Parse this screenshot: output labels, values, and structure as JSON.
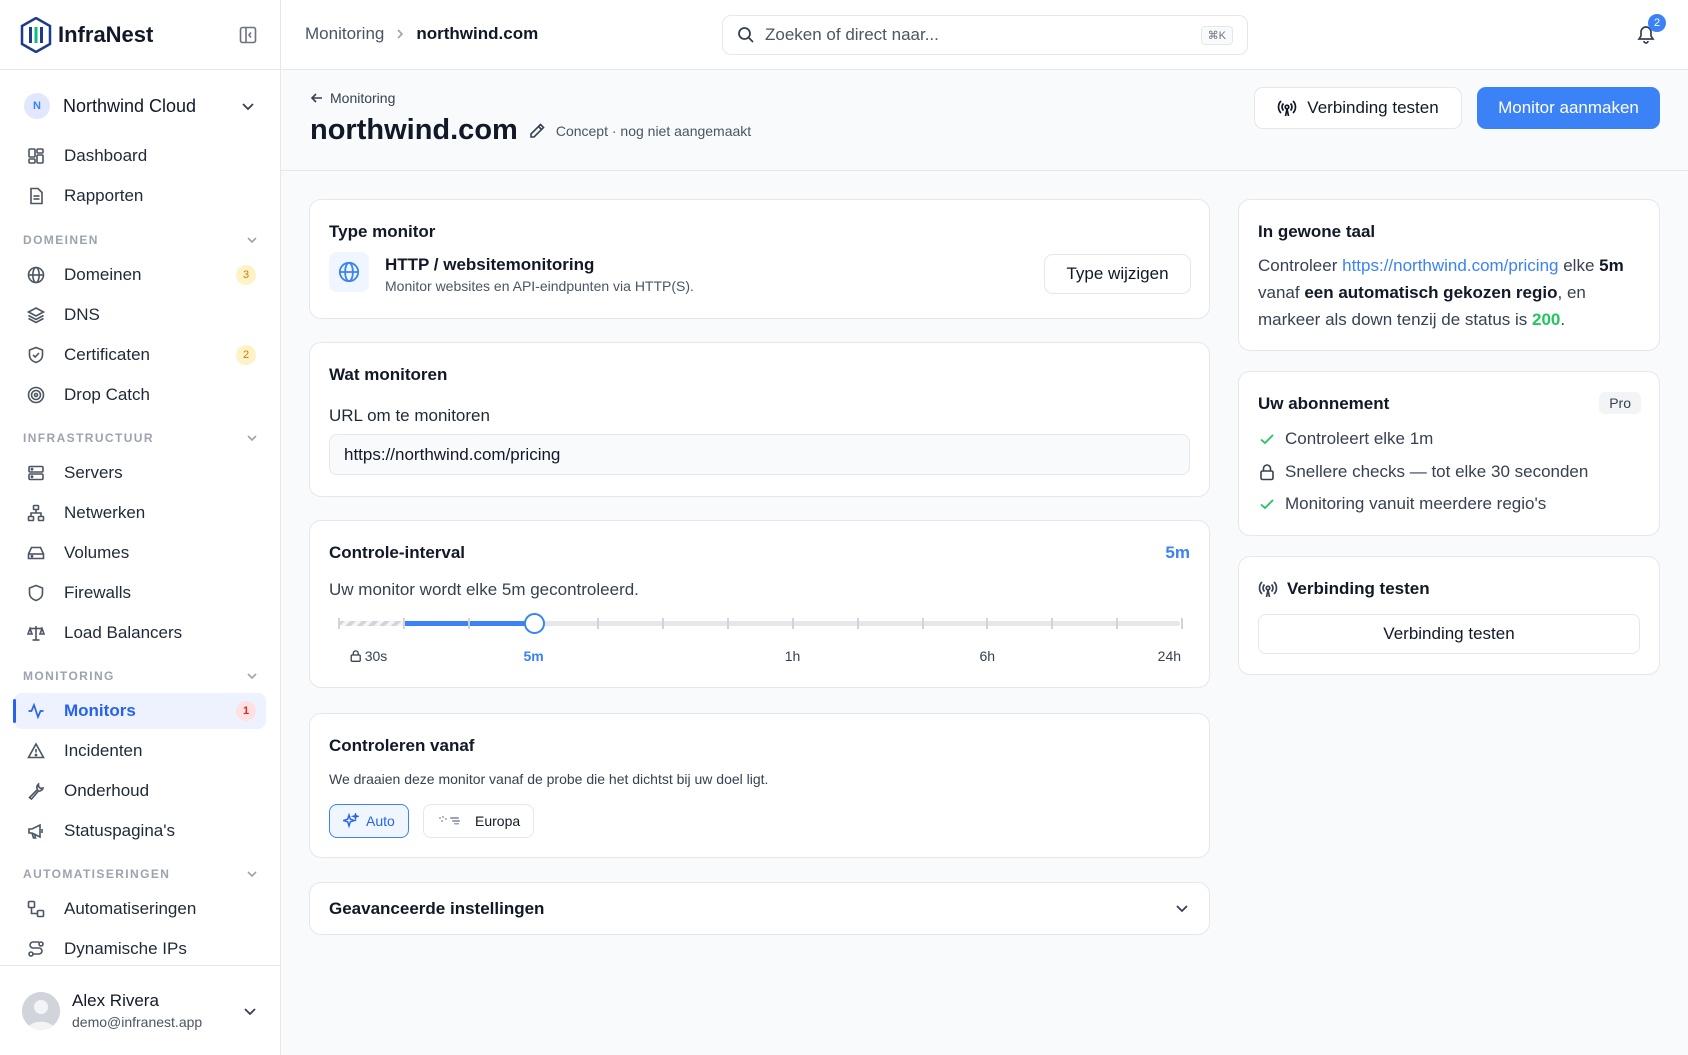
{
  "brand": {
    "name": "InfraNest"
  },
  "org": {
    "initial": "N",
    "name": "Northwind Cloud"
  },
  "nav": {
    "dashboard": "Dashboard",
    "reports": "Rapporten",
    "sections": {
      "domains": "DOMEINEN",
      "infra": "INFRASTRUCTUUR",
      "monitoring": "MONITORING",
      "automations": "AUTOMATISERINGEN"
    },
    "domains": "Domeinen",
    "domains_badge": "3",
    "dns": "DNS",
    "certificates": "Certificaten",
    "certificates_badge": "2",
    "dropcatch": "Drop Catch",
    "servers": "Servers",
    "networks": "Netwerken",
    "volumes": "Volumes",
    "firewalls": "Firewalls",
    "loadbalancers": "Load Balancers",
    "monitors": "Monitors",
    "monitors_badge": "1",
    "incidents": "Incidenten",
    "maintenance": "Onderhoud",
    "statuspages": "Statuspagina's",
    "automations": "Automatiseringen",
    "dynamic_ips": "Dynamische IPs"
  },
  "user": {
    "name": "Alex Rivera",
    "email": "demo@infranest.app"
  },
  "topbar": {
    "crumb_parent": "Monitoring",
    "crumb_current": "northwind.com",
    "search_placeholder": "Zoeken of direct naar...",
    "search_shortcut": "⌘K",
    "notifications_count": "2"
  },
  "header": {
    "back_label": "Monitoring",
    "title": "northwind.com",
    "draft_status": "Concept · nog niet aangemaakt",
    "test_button": "Verbinding testen",
    "create_button": "Monitor aanmaken"
  },
  "type_card": {
    "title": "Type monitor",
    "type_name": "HTTP / websitemonitoring",
    "type_desc": "Monitor websites en API-eindpunten via HTTP(S).",
    "change_button": "Type wijzigen"
  },
  "what_card": {
    "title": "Wat monitoren",
    "url_label": "URL om te monitoren",
    "url_value": "https://northwind.com/pricing"
  },
  "interval_card": {
    "title": "Controle-interval",
    "value": "5m",
    "description": "Uw monitor wordt elke 5m gecontroleerd.",
    "labels": [
      "30s",
      "5m",
      "1h",
      "6h",
      "24h"
    ],
    "selected_fraction": 0.2308
  },
  "from_card": {
    "title": "Controleren vanaf",
    "description": "We draaien deze monitor vanaf de probe die het dichtst bij uw doel ligt.",
    "chip_auto": "Auto",
    "chip_europe": "Europa"
  },
  "advanced": {
    "title": "Geavanceerde instellingen"
  },
  "plain_card": {
    "title": "In gewone taal",
    "p1": "Controleer ",
    "url": "https://northwind.com/pricing",
    "p2": " elke ",
    "interval": "5m",
    "p3": " vanaf ",
    "region": "een automatisch gekozen regio",
    "p4": ", en markeer als down tenzij de status is ",
    "status": "200",
    "p5": "."
  },
  "plan_card": {
    "title": "Uw abonnement",
    "badge": "Pro",
    "features": [
      "Controleert elke 1m",
      "Snellere checks — tot elke 30 seconden",
      "Monitoring vanuit meerdere regio's"
    ]
  },
  "test_card": {
    "title": "Verbinding testen",
    "button": "Verbinding testen"
  },
  "colors": {
    "accent": "#3b82f6",
    "success": "#22c55e",
    "badge_amber": "#d97706",
    "badge_red": "#dc2626"
  }
}
